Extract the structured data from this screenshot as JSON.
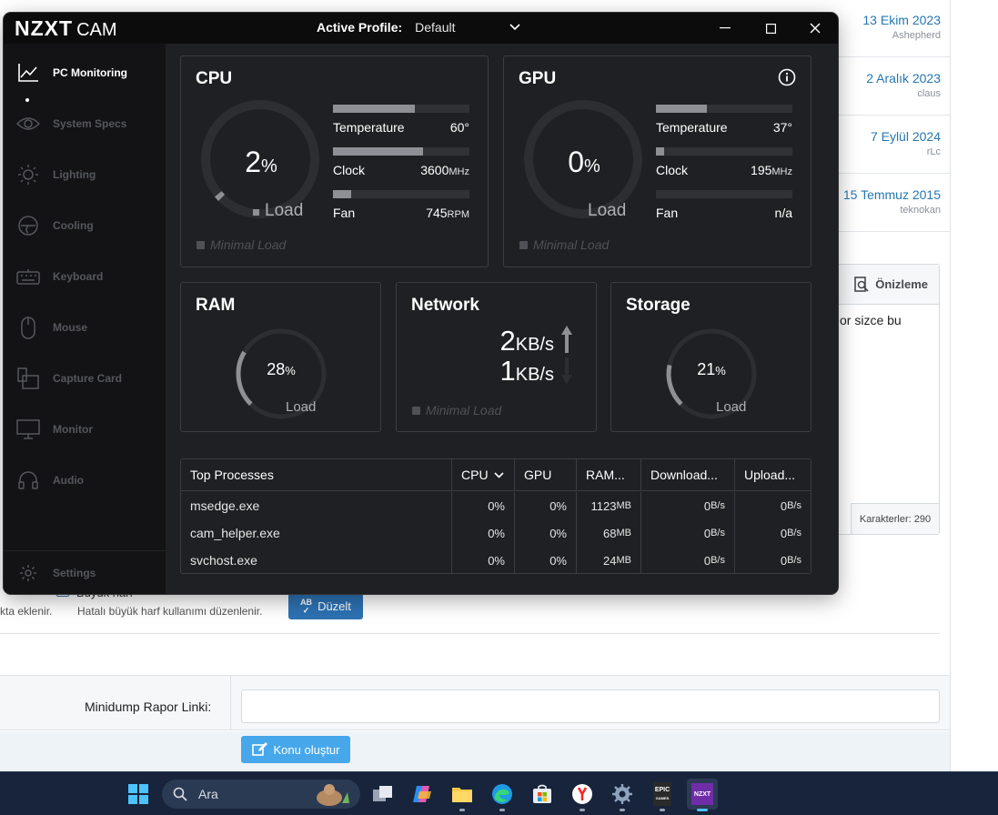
{
  "background": {
    "threads": [
      {
        "date": "13 Ekim 2023",
        "user": "Ashepherd"
      },
      {
        "date": "2 Aralık 2023",
        "user": "claus"
      },
      {
        "date": "7 Eylül 2024",
        "user": "rLc"
      },
      {
        "date": "15 Temmuz 2015",
        "user": "teknokan"
      }
    ],
    "preview_label": "Önizleme",
    "preview_text": "or sizce bu",
    "char_count": "Karakterler: 290",
    "option_title": "Büyük harf",
    "left_cut_text": "kta eklenir.",
    "option_desc": "Hatalı büyük harf kullanımı düzenlenir.",
    "fix_button": "Düzelt",
    "fix_icon_text": "AB",
    "minidump_label": "Minidump Rapor Linki:",
    "minidump_value": "",
    "create_button": "Konu oluştur"
  },
  "app": {
    "logo": "NZXT",
    "logo_suffix": "CAM",
    "profile_label": "Active Profile:",
    "profile_value": "Default",
    "sidebar": [
      {
        "label": "PC Monitoring",
        "icon": "chart-line-icon",
        "active": true
      },
      {
        "label": "System Specs",
        "icon": "eye-icon",
        "active": false
      },
      {
        "label": "Lighting",
        "icon": "sun-icon",
        "active": false
      },
      {
        "label": "Cooling",
        "icon": "fan-icon",
        "active": false
      },
      {
        "label": "Keyboard",
        "icon": "keyboard-icon",
        "active": false
      },
      {
        "label": "Mouse",
        "icon": "mouse-icon",
        "active": false
      },
      {
        "label": "Capture Card",
        "icon": "capture-card-icon",
        "active": false
      },
      {
        "label": "Monitor",
        "icon": "monitor-icon",
        "active": false
      },
      {
        "label": "Audio",
        "icon": "headset-icon",
        "active": false
      }
    ],
    "settings_label": "Settings",
    "cpu": {
      "title": "CPU",
      "load_value": "2",
      "load_unit": "%",
      "load_fraction": 0.02,
      "load_label": "Load",
      "minimal_load": "Minimal Load",
      "metrics": [
        {
          "label": "Temperature",
          "value": "60°",
          "unit": "",
          "fill": 0.6
        },
        {
          "label": "Clock",
          "value": "3600",
          "unit": "MHz",
          "fill": 0.66
        },
        {
          "label": "Fan",
          "value": "745",
          "unit": "RPM",
          "fill": 0.13
        }
      ]
    },
    "gpu": {
      "title": "GPU",
      "load_value": "0",
      "load_unit": "%",
      "load_fraction": 0.0,
      "load_label": "Load",
      "minimal_load": "Minimal Load",
      "metrics": [
        {
          "label": "Temperature",
          "value": "37°",
          "unit": "",
          "fill": 0.37
        },
        {
          "label": "Clock",
          "value": "195",
          "unit": "MHz",
          "fill": 0.06
        },
        {
          "label": "Fan",
          "value": "n/a",
          "unit": "",
          "fill": 0.0
        }
      ]
    },
    "ram": {
      "title": "RAM",
      "value": "28",
      "unit": "%",
      "fraction": 0.28,
      "label": "Load"
    },
    "network": {
      "title": "Network",
      "down_value": "2",
      "down_unit": "KB/s",
      "up_value": "1",
      "up_unit": "KB/s",
      "minimal_load": "Minimal Load"
    },
    "storage": {
      "title": "Storage",
      "value": "21",
      "unit": "%",
      "fraction": 0.21,
      "label": "Load"
    },
    "processes": {
      "headers": [
        "Top Processes",
        "CPU",
        "GPU",
        "RAM...",
        "Download...",
        "Upload..."
      ],
      "rows": [
        {
          "name": "msedge.exe",
          "cpu": "0%",
          "gpu": "0%",
          "ram": "1123",
          "ram_unit": "MB",
          "down": "0",
          "down_unit": "B/s",
          "up": "0",
          "up_unit": "B/s"
        },
        {
          "name": "cam_helper.exe",
          "cpu": "0%",
          "gpu": "0%",
          "ram": "68",
          "ram_unit": "MB",
          "down": "0",
          "down_unit": "B/s",
          "up": "0",
          "up_unit": "B/s"
        },
        {
          "name": "svchost.exe",
          "cpu": "0%",
          "gpu": "0%",
          "ram": "24",
          "ram_unit": "MB",
          "down": "0",
          "down_unit": "B/s",
          "up": "0",
          "up_unit": "B/s"
        }
      ]
    }
  },
  "taskbar": {
    "search_placeholder": "Ara",
    "apps": [
      "windows-start-icon",
      "task-view-icon",
      "copilot-icon",
      "file-explorer-icon",
      "edge-icon",
      "store-icon",
      "yandex-icon",
      "settings-gear-icon",
      "epic-games-icon",
      "nzxt-cam-icon"
    ],
    "epic_text": "EPIC",
    "epic_subtext": "GAMES",
    "nzxt_text": "NZXT"
  }
}
